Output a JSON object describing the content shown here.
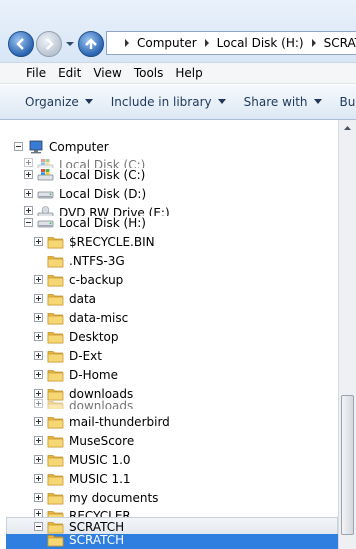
{
  "address": {
    "crumbs": [
      "Computer",
      "Local Disk (H:)",
      "SCRATCH"
    ]
  },
  "menu": [
    "File",
    "Edit",
    "View",
    "Tools",
    "Help"
  ],
  "commands": [
    "Organize",
    "Include in library",
    "Share with",
    "Bu"
  ],
  "tree": {
    "computer": "Computer",
    "c_drive": "Local Disk (C:)",
    "d_drive": "Local Disk (D:)",
    "dvd": "DVD RW Drive (E:)",
    "h_drive": "Local Disk (H:)",
    "folders": [
      "$RECYCLE.BIN",
      ".NTFS-3G",
      "c-backup",
      "data",
      "data-misc",
      "Desktop",
      "D-Ext",
      "D-Home",
      "downloads",
      "mail-thunderbird",
      "MuseScore",
      "MUSIC 1.0",
      "MUSIC 1.1",
      "my documents",
      "RECYCLER",
      "SCRATCH"
    ]
  },
  "colors": {
    "accent": "#2f7fe0",
    "folder": "#f3cd5c",
    "command_text": "#1e395b"
  }
}
